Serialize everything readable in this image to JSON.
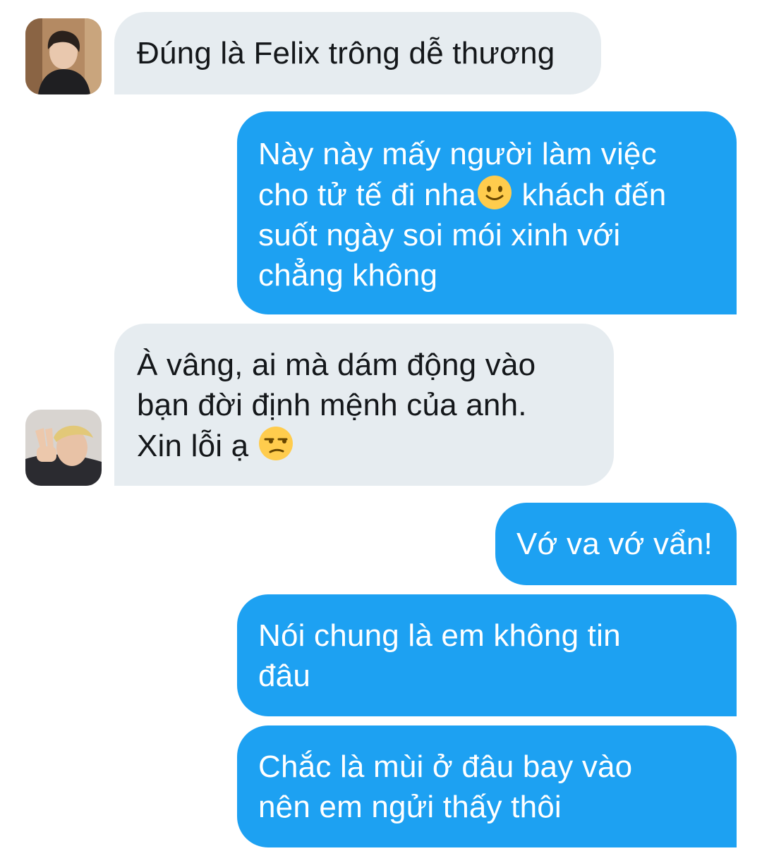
{
  "conversation": {
    "messages": [
      {
        "direction": "incoming",
        "avatar_icon": "user-avatar-photo",
        "lines": [
          "Đúng là Felix trông dễ thương"
        ]
      },
      {
        "direction": "outgoing",
        "lines": [
          "Này này mấy người làm việc",
          "cho tử tế đi nha",
          "khách đến",
          "suốt ngày soi mói xinh với",
          "chẳng không"
        ],
        "emoji": "slightly-smiling-face"
      },
      {
        "direction": "incoming",
        "avatar_icon": "user-avatar-photo",
        "lines": [
          "À vâng, ai mà dám động vào",
          "bạn đời định mệnh của anh.",
          "Xin lỗi ạ"
        ],
        "emoji": "unamused-face"
      },
      {
        "direction": "outgoing",
        "lines": [
          "Vớ va vớ vẩn!"
        ]
      },
      {
        "direction": "outgoing",
        "lines": [
          "Nói chung là em không tin",
          "đâu"
        ]
      },
      {
        "direction": "outgoing",
        "lines": [
          "Chắc là mùi ở đâu bay vào",
          "nên em ngửi thấy thôi"
        ]
      }
    ]
  },
  "colors": {
    "incoming_bubble": "#e6ecf0",
    "incoming_text": "#14171a",
    "outgoing_bubble": "#1da1f2",
    "outgoing_text": "#ffffff"
  }
}
